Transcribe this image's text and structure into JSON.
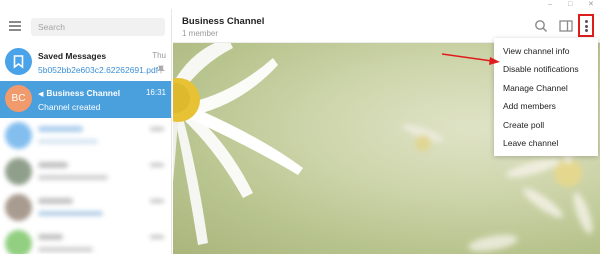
{
  "sidebar": {
    "search_placeholder": "Search",
    "chats": [
      {
        "name": "Saved Messages",
        "subtitle": "5b052bb2e603c2.62262691.pdf",
        "time": "Thu"
      },
      {
        "name": "Business Channel",
        "subtitle": "Channel created",
        "time": "16:31",
        "initials": "BC"
      }
    ]
  },
  "header": {
    "title": "Business Channel",
    "subtitle": "1 member"
  },
  "menu": {
    "items": [
      "View channel info",
      "Disable notifications",
      "Manage Channel",
      "Add members",
      "Create poll",
      "Leave channel"
    ]
  },
  "colors": {
    "active_chat": "#4a9fdd",
    "avatar_bc": "#f19a6c",
    "highlight": "#e01d1d"
  }
}
